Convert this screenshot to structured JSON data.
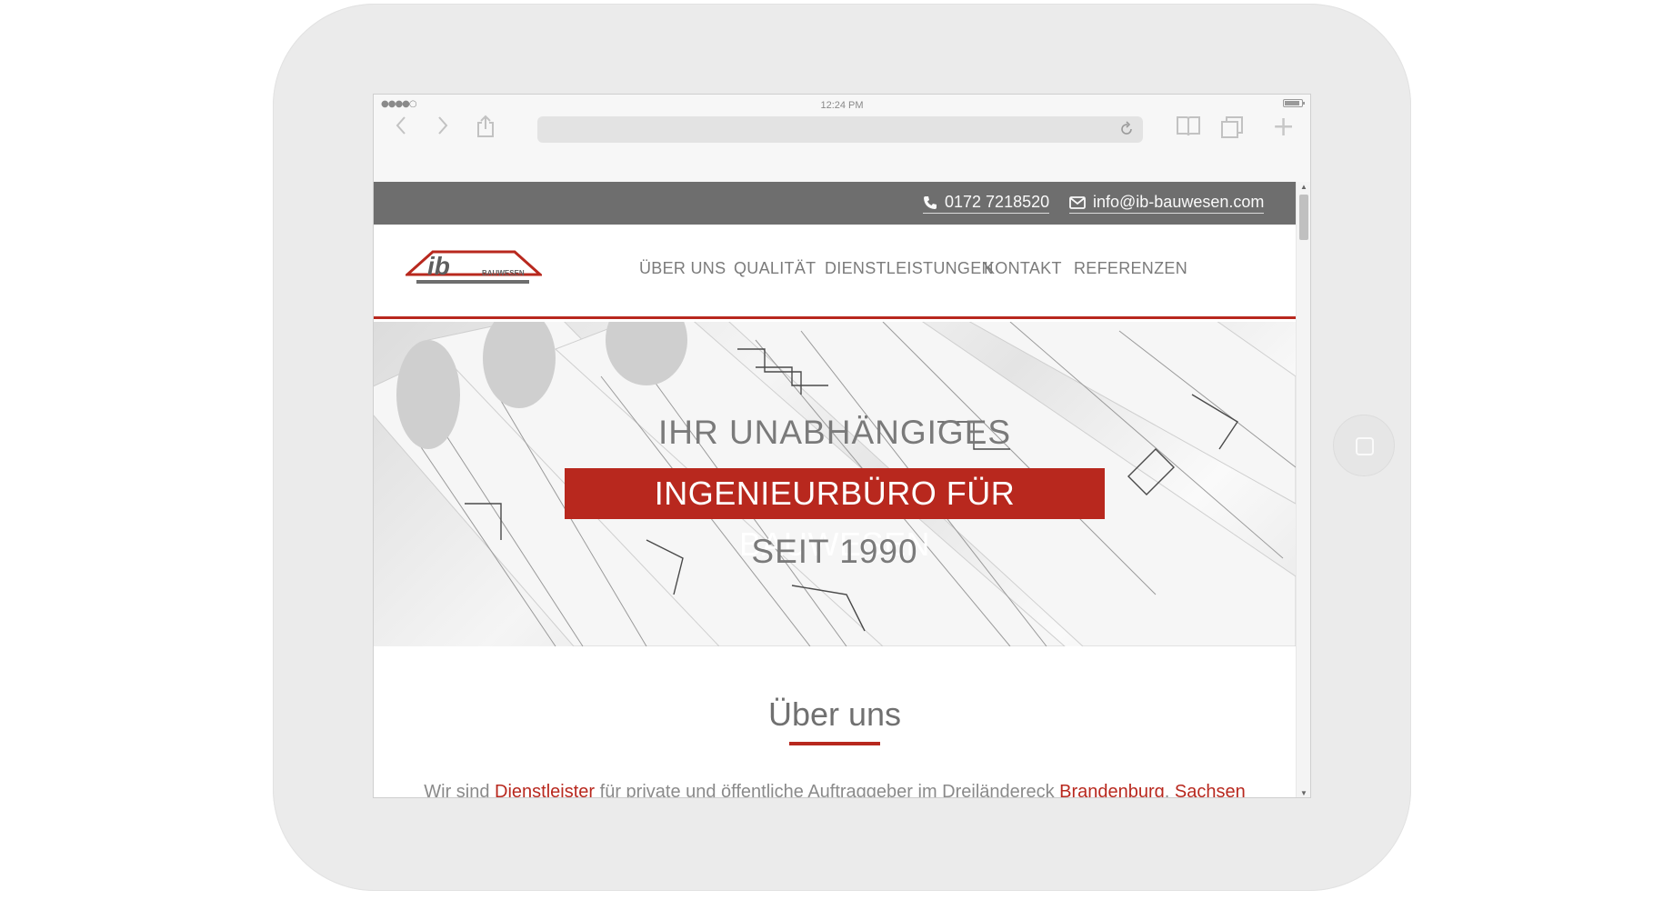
{
  "status_bar": {
    "signal": "●●●●○",
    "time": "12:24 PM"
  },
  "browser": {
    "back_icon": "chevron-left-icon",
    "forward_icon": "chevron-right-icon",
    "share_icon": "share-icon",
    "reload_icon": "reload-icon",
    "bookmarks_icon": "book-icon",
    "tabs_icon": "tabs-icon",
    "new_tab_label": "+"
  },
  "topbar": {
    "phone": "0172 7218520",
    "email": "info@ib-bauwesen.com"
  },
  "logo": {
    "mark": "ib",
    "text": "BAUWESEN"
  },
  "nav": {
    "items": [
      {
        "label": "ÜBER UNS"
      },
      {
        "label": "QUALITÄT"
      },
      {
        "label": "DIENSTLEISTUNGEN"
      },
      {
        "label": "KONTAKT"
      },
      {
        "label": "REFERENZEN"
      }
    ]
  },
  "hero": {
    "line1": "IHR UNABHÄNGIGES",
    "line2": "INGENIEURBÜRO FÜR BAUWESEN",
    "line3": "SEIT 1990"
  },
  "about": {
    "title": "Über uns",
    "text_parts": [
      "Wir sind ",
      "Dienstleister",
      " für private und öffentliche Auftraggeber im Dreiländereck ",
      "Brandenburg",
      ", ",
      "Sachsen"
    ]
  },
  "colors": {
    "accent": "#b8281e",
    "topbar": "#6e6e6e",
    "text_gray": "#7a7a7a"
  }
}
